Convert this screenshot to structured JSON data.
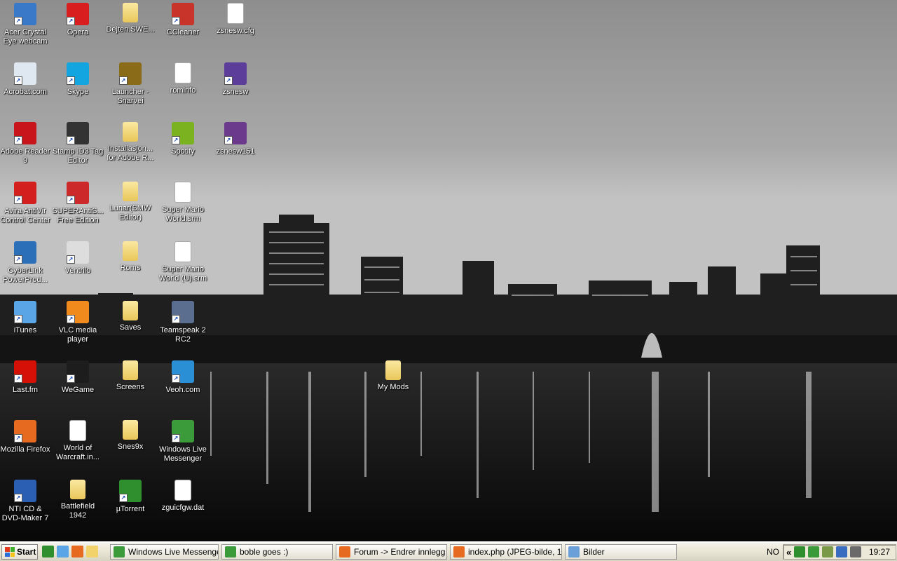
{
  "desktop": {
    "icons": [
      {
        "label": "Acer Crystal\nEye webcam",
        "icon": "webcam-icon",
        "color": "#3a78c8"
      },
      {
        "label": "Opera",
        "icon": "opera-icon",
        "color": "#d81e1e"
      },
      {
        "label": "Dejten.SWE...",
        "icon": "folder-icon",
        "color": "#f2d36b"
      },
      {
        "label": "CCleaner",
        "icon": "ccleaner-icon",
        "color": "#c8342a"
      },
      {
        "label": "zsnesw.cfg",
        "icon": "document-icon",
        "color": "#ffffff"
      },
      {
        "label": "Acrobat.com",
        "icon": "acrobat-com-icon",
        "color": "#dfe7f1"
      },
      {
        "label": "Skype",
        "icon": "skype-icon",
        "color": "#12a5e0"
      },
      {
        "label": "Launcher -\nSnarvei",
        "icon": "wow-launcher-icon",
        "color": "#8a6b18"
      },
      {
        "label": "rominfo",
        "icon": "text-file-icon",
        "color": "#ffffff"
      },
      {
        "label": "zsnesw",
        "icon": "zsnes-icon",
        "color": "#5d3d9a"
      },
      {
        "label": "Adobe Reader\n9",
        "icon": "adobe-reader-icon",
        "color": "#c8151b"
      },
      {
        "label": "Stamp ID3 Tag\nEditor",
        "icon": "stamp-icon",
        "color": "#333333"
      },
      {
        "label": "Installasjon...\nfor Adobe R...",
        "icon": "installer-folder-icon",
        "color": "#f2d36b"
      },
      {
        "label": "Spotify",
        "icon": "spotify-icon",
        "color": "#7ab31f"
      },
      {
        "label": "zsnesw151",
        "icon": "winrar-archive-icon",
        "color": "#6b3a8c"
      },
      {
        "label": "Avira AntiVir\nControl Center",
        "icon": "avira-icon",
        "color": "#d41f1f"
      },
      {
        "label": "SUPERAntiS...\nFree Edition",
        "icon": "superantispyware-icon",
        "color": "#cc2a2a"
      },
      {
        "label": "Lunar(SMW\nEditor)",
        "icon": "folder-icon",
        "color": "#f2d36b"
      },
      {
        "label": "Super Mario\nWorld.srm",
        "icon": "document-icon",
        "color": "#ffffff"
      },
      {
        "label": "CyberLink\nPowerProd...",
        "icon": "cyberlink-icon",
        "color": "#2a6fb8"
      },
      {
        "label": "Ventrilo",
        "icon": "ventrilo-icon",
        "color": "#dddddd"
      },
      {
        "label": "Roms",
        "icon": "folder-icon",
        "color": "#f2d36b"
      },
      {
        "label": "Super Mario\nWorld (U).srm",
        "icon": "document-icon",
        "color": "#ffffff"
      },
      {
        "label": "iTunes",
        "icon": "itunes-icon",
        "color": "#5aa5e6"
      },
      {
        "label": "VLC media\nplayer",
        "icon": "vlc-icon",
        "color": "#f08a1c"
      },
      {
        "label": "Saves",
        "icon": "folder-icon",
        "color": "#f2d36b"
      },
      {
        "label": "Teamspeak 2\nRC2",
        "icon": "teamspeak-icon",
        "color": "#5b6e8f"
      },
      {
        "label": "Last.fm",
        "icon": "lastfm-icon",
        "color": "#d51007"
      },
      {
        "label": "WeGame",
        "icon": "wegame-icon",
        "color": "#1d1d1d"
      },
      {
        "label": "Screens",
        "icon": "folder-icon",
        "color": "#f2d36b"
      },
      {
        "label": "Veoh.com",
        "icon": "veoh-icon",
        "color": "#2b8fd6"
      },
      {
        "label": "My Mods",
        "icon": "folder-icon",
        "color": "#f2d36b"
      },
      {
        "label": "Mozilla Firefox",
        "icon": "firefox-icon",
        "color": "#e66a1f"
      },
      {
        "label": "World of\nWarcraft.in...",
        "icon": "document-icon",
        "color": "#ffffff"
      },
      {
        "label": "Snes9x",
        "icon": "folder-icon",
        "color": "#f2d36b"
      },
      {
        "label": "Windows Live\nMessenger",
        "icon": "messenger-icon",
        "color": "#3b9b3b"
      },
      {
        "label": "NTI CD &\nDVD-Maker 7",
        "icon": "nti-icon",
        "color": "#2b5fb4"
      },
      {
        "label": "Battlefield\n1942",
        "icon": "folder-icon",
        "color": "#f2d36b"
      },
      {
        "label": "µTorrent",
        "icon": "utorrent-icon",
        "color": "#2f8f2f"
      },
      {
        "label": "zguicfgw.dat",
        "icon": "document-icon",
        "color": "#ffffff"
      }
    ]
  },
  "taskbar": {
    "start_label": "Start",
    "quick_launch": [
      {
        "icon": "utorrent-icon",
        "color": "#2f8f2f"
      },
      {
        "icon": "itunes-icon",
        "color": "#5aa5e6"
      },
      {
        "icon": "firefox-icon",
        "color": "#e66a1f"
      },
      {
        "icon": "folder-icon",
        "color": "#f2d36b"
      }
    ],
    "tasks": [
      {
        "label": "Windows Live Messenger",
        "icon": "messenger-icon",
        "color": "#3b9b3b"
      },
      {
        "label": "boble goes :)",
        "icon": "messenger-icon",
        "color": "#3b9b3b"
      },
      {
        "label": "Forum -> Endrer innlegg ...",
        "icon": "firefox-icon",
        "color": "#e66a1f"
      },
      {
        "label": "index.php (JPEG-bilde, 1...",
        "icon": "firefox-icon",
        "color": "#e66a1f"
      },
      {
        "label": "Bilder",
        "icon": "folder-window-icon",
        "color": "#6a9fd8"
      }
    ],
    "language": "NO",
    "tray_expand": "«",
    "tray_icons": [
      {
        "icon": "utorrent-tray-icon",
        "color": "#2f8f2f"
      },
      {
        "icon": "messenger-tray-icon",
        "color": "#3b9b3b"
      },
      {
        "icon": "safely-remove-icon",
        "color": "#7a9a4a"
      },
      {
        "icon": "network-icon",
        "color": "#3a6cc0"
      },
      {
        "icon": "volume-icon",
        "color": "#6a6a6a"
      }
    ],
    "clock": "19:27"
  }
}
